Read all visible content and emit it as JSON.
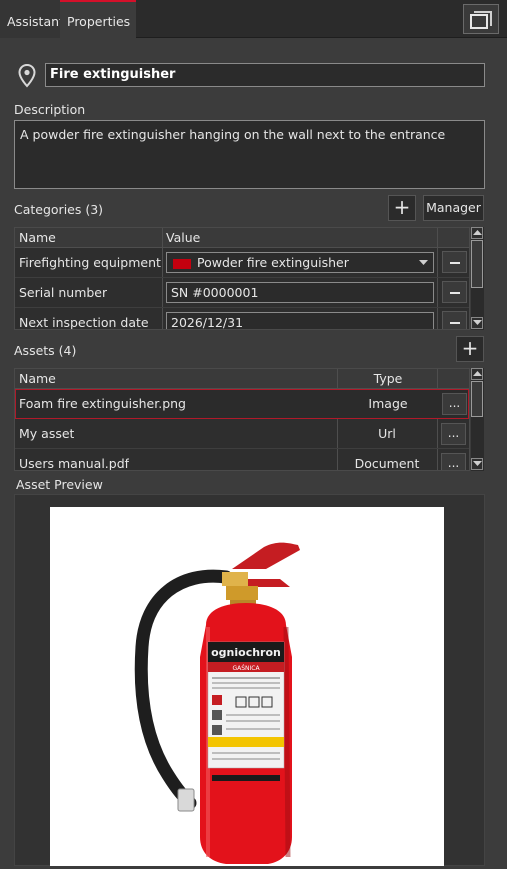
{
  "tabs": [
    {
      "label": "Assistant"
    },
    {
      "label": "Properties",
      "active": true
    }
  ],
  "object": {
    "name": "Fire extinguisher",
    "description_label": "Description",
    "description": "A powder fire extinguisher hanging on the wall next to the entrance"
  },
  "categories": {
    "label": "Categories (3)",
    "add_label": "+",
    "manager_label": "Manager",
    "columns": [
      "Name",
      "Value"
    ],
    "rows": [
      {
        "name": "Firefighting equipment",
        "value": "Powder fire extinguisher",
        "swatch": "#c4000f"
      },
      {
        "name": "Serial number",
        "value": "SN #0000001"
      },
      {
        "name": "Next inspection date",
        "value": "2026/12/31"
      }
    ]
  },
  "assets": {
    "label": "Assets (4)",
    "add_label": "+",
    "columns": [
      "Name",
      "Type"
    ],
    "rows": [
      {
        "name": "Foam fire extinguisher.png",
        "type": "Image",
        "selected": true
      },
      {
        "name": "My asset",
        "type": "Url"
      },
      {
        "name": "Users manual.pdf",
        "type": "Document"
      }
    ],
    "more_label": "..."
  },
  "preview": {
    "label": "Asset Preview",
    "brand_text": "ogniochron",
    "sub_text": "GAŚNICA"
  },
  "colors": {
    "accent": "#d4102a",
    "selection_border": "#b01a2a",
    "extinguisher_red": "#e3121b"
  }
}
